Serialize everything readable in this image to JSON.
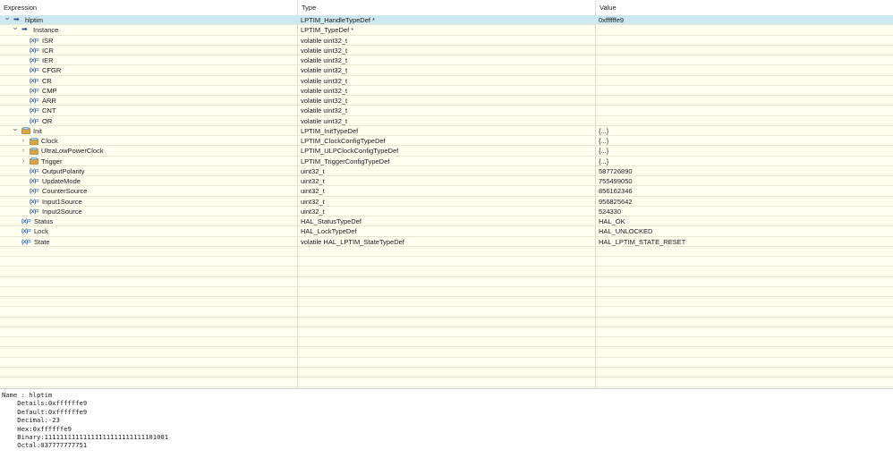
{
  "columns": {
    "expression": "Expression",
    "type": "Type",
    "value": "Value"
  },
  "rows": [
    {
      "name": "hlptim",
      "type": "LPTIM_HandleTypeDef *",
      "value": "0xffffffe9",
      "depth": 0,
      "twisty": "down",
      "icon": "pointer-icon",
      "selected": true
    },
    {
      "name": "Instance",
      "type": "LPTIM_TypeDef *",
      "value": "",
      "depth": 1,
      "twisty": "down",
      "icon": "pointer-icon"
    },
    {
      "name": "ISR",
      "type": "volatile uint32_t",
      "value": "",
      "depth": 2,
      "twisty": "",
      "icon": "variable-icon"
    },
    {
      "name": "ICR",
      "type": "volatile uint32_t",
      "value": "",
      "depth": 2,
      "twisty": "",
      "icon": "variable-icon"
    },
    {
      "name": "IER",
      "type": "volatile uint32_t",
      "value": "",
      "depth": 2,
      "twisty": "",
      "icon": "variable-icon"
    },
    {
      "name": "CFGR",
      "type": "volatile uint32_t",
      "value": "",
      "depth": 2,
      "twisty": "",
      "icon": "variable-icon"
    },
    {
      "name": "CR",
      "type": "volatile uint32_t",
      "value": "",
      "depth": 2,
      "twisty": "",
      "icon": "variable-icon"
    },
    {
      "name": "CMP",
      "type": "volatile uint32_t",
      "value": "",
      "depth": 2,
      "twisty": "",
      "icon": "variable-icon"
    },
    {
      "name": "ARR",
      "type": "volatile uint32_t",
      "value": "",
      "depth": 2,
      "twisty": "",
      "icon": "variable-icon"
    },
    {
      "name": "CNT",
      "type": "volatile uint32_t",
      "value": "",
      "depth": 2,
      "twisty": "",
      "icon": "variable-icon"
    },
    {
      "name": "OR",
      "type": "volatile uint32_t",
      "value": "",
      "depth": 2,
      "twisty": "",
      "icon": "variable-icon"
    },
    {
      "name": "Init",
      "type": "LPTIM_InitTypeDef",
      "value": "{...}",
      "depth": 1,
      "twisty": "down",
      "icon": "struct-icon"
    },
    {
      "name": "Clock",
      "type": "LPTIM_ClockConfigTypeDef",
      "value": "{...}",
      "depth": 2,
      "twisty": "right",
      "icon": "struct-icon"
    },
    {
      "name": "UltraLowPowerClock",
      "type": "LPTIM_ULPClockConfigTypeDef",
      "value": "{...}",
      "depth": 2,
      "twisty": "right",
      "icon": "struct-icon"
    },
    {
      "name": "Trigger",
      "type": "LPTIM_TriggerConfigTypeDef",
      "value": "{...}",
      "depth": 2,
      "twisty": "right",
      "icon": "struct-icon"
    },
    {
      "name": "OutputPolarity",
      "type": "uint32_t",
      "value": "587726890",
      "depth": 2,
      "twisty": "",
      "icon": "variable-icon"
    },
    {
      "name": "UpdateMode",
      "type": "uint32_t",
      "value": "755499050",
      "depth": 2,
      "twisty": "",
      "icon": "variable-icon"
    },
    {
      "name": "CounterSource",
      "type": "uint32_t",
      "value": "856162346",
      "depth": 2,
      "twisty": "",
      "icon": "variable-icon"
    },
    {
      "name": "Input1Source",
      "type": "uint32_t",
      "value": "956825642",
      "depth": 2,
      "twisty": "",
      "icon": "variable-icon"
    },
    {
      "name": "Input2Source",
      "type": "uint32_t",
      "value": "524330",
      "depth": 2,
      "twisty": "",
      "icon": "variable-icon"
    },
    {
      "name": "Status",
      "type": "HAL_StatusTypeDef",
      "value": "HAL_OK",
      "depth": 1,
      "twisty": "",
      "icon": "variable-icon"
    },
    {
      "name": "Lock",
      "type": "HAL_LockTypeDef",
      "value": "HAL_UNLOCKED",
      "depth": 1,
      "twisty": "",
      "icon": "variable-icon"
    },
    {
      "name": "State",
      "type": "volatile HAL_LPTIM_StateTypeDef",
      "value": "HAL_LPTIM_STATE_RESET",
      "depth": 1,
      "twisty": "",
      "icon": "variable-icon"
    }
  ],
  "empty_rows": 14,
  "icons": {
    "variable": "(x)=",
    "pointer": "➡"
  },
  "colors": {
    "selection": "#cde8f0",
    "grid_bg": "#fffff0",
    "struct_icon": "#d9a441"
  },
  "details": [
    "Name : hlptim",
    "    Details:0xffffffe9",
    "    Default:0xffffffe9",
    "    Decimal:-23",
    "    Hex:0xffffffe9",
    "    Binary:11111111111111111111111111101001",
    "    Octal:037777777751"
  ]
}
